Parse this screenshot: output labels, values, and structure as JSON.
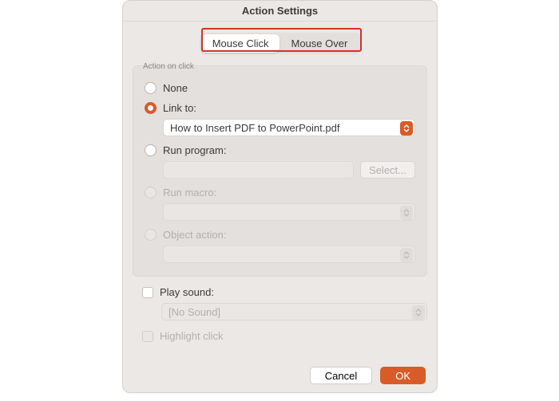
{
  "title": "Action Settings",
  "tabs": {
    "click": "Mouse Click",
    "over": "Mouse Over"
  },
  "group_label": "Action on click",
  "options": {
    "none": "None",
    "link_to": "Link to:",
    "link_value": "How to Insert PDF to PowerPoint.pdf",
    "run_program": "Run program:",
    "select_btn": "Select...",
    "run_macro": "Run macro:",
    "object_action": "Object action:"
  },
  "play_sound": "Play sound:",
  "no_sound": "[No Sound]",
  "highlight_click": "Highlight click",
  "buttons": {
    "cancel": "Cancel",
    "ok": "OK"
  }
}
